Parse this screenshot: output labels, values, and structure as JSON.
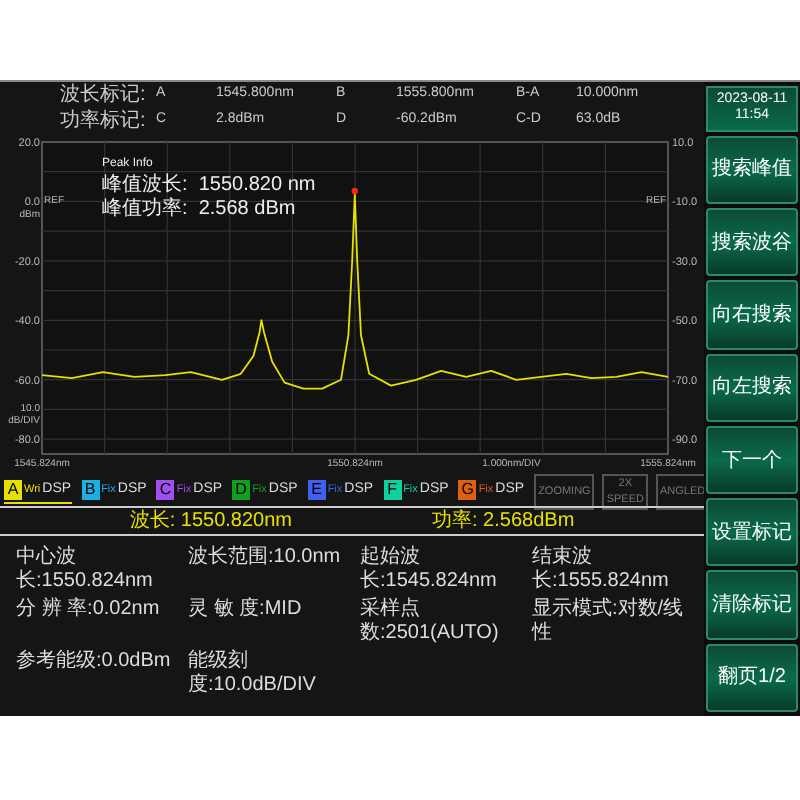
{
  "markers": [
    {
      "label": "波长标记:",
      "items": [
        {
          "name": "A",
          "value": "1545.800nm"
        },
        {
          "name": "B",
          "value": "1555.800nm"
        },
        {
          "name": "B-A",
          "value": "10.000nm"
        }
      ]
    },
    {
      "label": "功率标记:",
      "items": [
        {
          "name": "C",
          "value": "2.8dBm"
        },
        {
          "name": "D",
          "value": "-60.2dBm"
        },
        {
          "name": "C-D",
          "value": "63.0dB"
        }
      ]
    }
  ],
  "plot": {
    "chart_data": {
      "type": "line",
      "grid": true,
      "xlim": [
        1545.824,
        1555.824
      ],
      "ylim": [
        -85,
        20
      ],
      "xticks": [
        {
          "value": 1545.824,
          "label": "1545.824nm"
        },
        {
          "value": 1550.824,
          "label": "1550.824nm"
        },
        {
          "value": 1555.824,
          "label": "1555.824nm"
        }
      ],
      "yticks": [
        {
          "value": 20,
          "label": "20.0"
        },
        {
          "value": 0,
          "label": "0.0"
        },
        {
          "value": -20,
          "label": "-20.0"
        },
        {
          "value": -40,
          "label": "-40.0"
        },
        {
          "value": -60,
          "label": "-60.0"
        },
        {
          "value": -80,
          "label": "-80.0"
        }
      ],
      "x": [
        1545.824,
        1546.3,
        1546.8,
        1547.3,
        1547.8,
        1548.2,
        1548.7,
        1549.0,
        1549.2,
        1549.3,
        1549.33,
        1549.37,
        1549.5,
        1549.7,
        1550.0,
        1550.3,
        1550.6,
        1550.72,
        1550.78,
        1550.82,
        1550.86,
        1550.92,
        1551.05,
        1551.4,
        1551.8,
        1552.2,
        1552.6,
        1553.0,
        1553.4,
        1553.8,
        1554.2,
        1554.6,
        1555.0,
        1555.4,
        1555.824
      ],
      "series": [
        {
          "color": "#e8e000",
          "values": [
            -58.5,
            -59.5,
            -57.5,
            -59,
            -58.5,
            -57.5,
            -60,
            -58,
            -52,
            -44,
            -40,
            -44,
            -54,
            -61,
            -63,
            -63,
            -60,
            -45,
            -20,
            2.5,
            -20,
            -45,
            -58,
            -62,
            -60,
            -57,
            -59,
            -57,
            -60,
            -59,
            -58,
            -59.5,
            -59,
            -57.5,
            -59
          ]
        }
      ]
    },
    "left_axis": [
      "dBm",
      "10.0",
      "dB/DIV"
    ],
    "right_axis": [
      "10.0",
      "-10.0",
      "-30.0",
      "-50.0",
      "-70.0",
      "-90.0"
    ],
    "ref_left": "REF",
    "ref_right": "REF",
    "x_scale": "1.000nm/DIV",
    "peak_info": {
      "title": "Peak Info",
      "lines": [
        "峰值波长:  1550.820 nm",
        "峰值功率:  2.568 dBm"
      ]
    }
  },
  "traces": [
    {
      "letter": "A",
      "mode": "Wri",
      "display": "DSP",
      "color": "#e8e000",
      "selected": true
    },
    {
      "letter": "B",
      "mode": "Fix",
      "display": "DSP",
      "color": "#1ab0e0",
      "selected": false
    },
    {
      "letter": "C",
      "mode": "Fix",
      "display": "DSP",
      "color": "#a050f0",
      "selected": false
    },
    {
      "letter": "D",
      "mode": "Fix",
      "display": "DSP",
      "color": "#10a020",
      "selected": false
    },
    {
      "letter": "E",
      "mode": "Fix",
      "display": "DSP",
      "color": "#4060f0",
      "selected": false
    },
    {
      "letter": "F",
      "mode": "Fix",
      "display": "DSP",
      "color": "#10d0a0",
      "selected": false
    },
    {
      "letter": "G",
      "mode": "Fix",
      "display": "DSP",
      "color": "#e06010",
      "selected": false
    }
  ],
  "modes": [
    {
      "label": "ZOOMING",
      "disabled": true
    },
    {
      "label": "2X SPEED",
      "disabled": true
    },
    {
      "label": "ANGLED",
      "disabled": true
    }
  ],
  "readout": {
    "wavelength": "波长: 1550.820nm",
    "power": "功率: 2.568dBm"
  },
  "params": [
    [
      "中心波长:1550.824nm",
      "波长范围:10.0nm",
      "起始波长:1545.824nm",
      "结束波长:1555.824nm"
    ],
    [
      "分 辨 率:0.02nm",
      "灵 敏 度:MID",
      "采样点数:2501(AUTO)",
      "显示模式:对数/线性"
    ],
    [
      "参考能级:0.0dBm",
      "能级刻度:10.0dB/DIV"
    ]
  ],
  "sidebar": {
    "date": "2023-08-11",
    "time": "11:54",
    "buttons": [
      "搜索峰值",
      "搜索波谷",
      "向右搜索",
      "向左搜索",
      "下一个",
      "设置标记",
      "清除标记",
      "翻页1/2"
    ]
  }
}
